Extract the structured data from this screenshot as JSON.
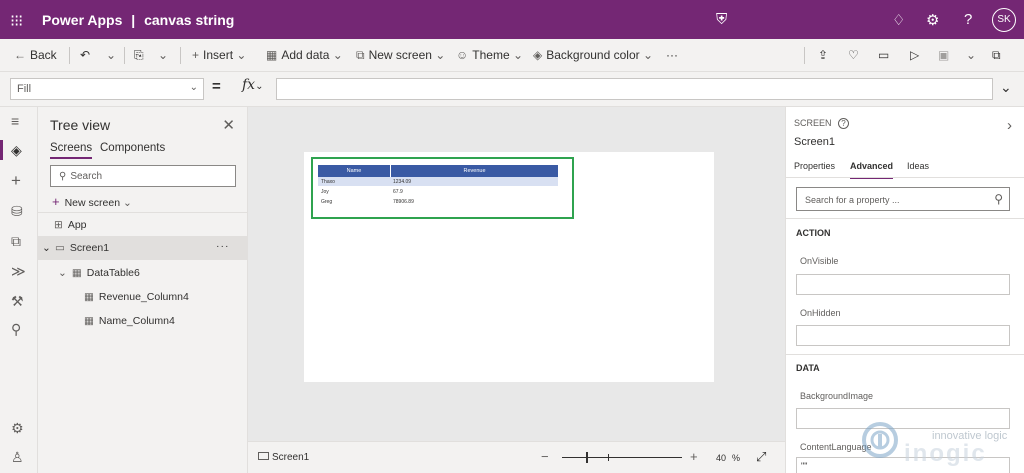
{
  "app": {
    "brand": "Power Apps",
    "separator": "|",
    "app_name": "canvas string",
    "user_initials": "SK"
  },
  "toolbar": {
    "back": "Back",
    "insert": "Insert",
    "add_data": "Add data",
    "new_screen": "New screen",
    "theme": "Theme",
    "background_color": "Background color",
    "more": "···"
  },
  "formula": {
    "property": "Fill",
    "fx": "fx",
    "value": ""
  },
  "tree": {
    "title": "Tree view",
    "tabs": [
      "Screens",
      "Components"
    ],
    "search_placeholder": "Search",
    "new_screen": "New screen",
    "nodes": {
      "app": "App",
      "screen": "Screen1",
      "table": "DataTable6",
      "col1": "Revenue_Column4",
      "col2": "Name_Column4"
    }
  },
  "datatable": {
    "columns": [
      "Name",
      "Revenue"
    ],
    "rows": [
      {
        "name": "Thaxo",
        "revenue": "1234.09"
      },
      {
        "name": "Joy",
        "revenue": "67.9"
      },
      {
        "name": "Greg",
        "revenue": "78906.89"
      }
    ]
  },
  "status": {
    "screen": "Screen1",
    "zoom_value": "40",
    "zoom_unit": "%",
    "minus": "−",
    "plus": "+"
  },
  "properties": {
    "kind": "SCREEN",
    "name": "Screen1",
    "tabs": [
      "Properties",
      "Advanced",
      "Ideas"
    ],
    "search_placeholder": "Search for a property ...",
    "sections": {
      "action": "ACTION",
      "data": "DATA"
    },
    "fields": {
      "on_visible": "OnVisible",
      "on_hidden": "OnHidden",
      "background_image": "BackgroundImage",
      "content_language": "ContentLanguage",
      "content_language_value": "\"\""
    }
  },
  "watermark": {
    "tagline": "innovative logic",
    "logo": "inogic"
  },
  "colors": {
    "brand": "#742774",
    "selection": "#2fa34f",
    "table_header": "#3a5aa4"
  }
}
